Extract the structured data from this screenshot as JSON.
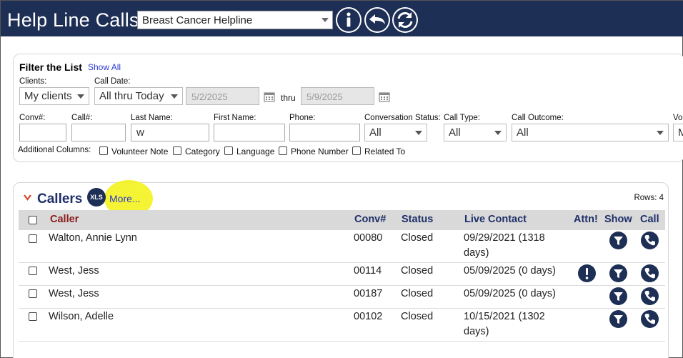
{
  "app": {
    "title": "Help Line Calls",
    "program": "Breast Cancer Helpline",
    "icons": [
      "info-icon",
      "back-icon",
      "refresh-icon"
    ]
  },
  "filter": {
    "title": "Filter the List",
    "show_all": "Show All",
    "clients_label": "Clients:",
    "clients_value": "My clients",
    "call_date_label": "Call Date:",
    "call_date_value": "All thru Today",
    "date_from": "5/2/2025",
    "thru_label": "thru",
    "date_to": "5/9/2025",
    "conv_label": "Conv#:",
    "conv_value": "",
    "call_label": "Call#:",
    "call_value": "",
    "last_name_label": "Last Name:",
    "last_name_value": "w",
    "first_name_label": "First Name:",
    "first_name_value": "",
    "phone_label": "Phone:",
    "phone_value": "",
    "conv_status_label": "Conversation Status:",
    "conv_status_value": "All",
    "call_type_label": "Call Type:",
    "call_type_value": "All",
    "call_outcome_label": "Call Outcome:",
    "call_outcome_value": "All",
    "vol_label": "Vol",
    "vol_value": "M",
    "additional_columns_label": "Additional Columns:",
    "additional_columns": [
      "Volunteer Note",
      "Category",
      "Language",
      "Phone Number",
      "Related To"
    ]
  },
  "callers": {
    "title": "Callers",
    "xls": "XLS",
    "more": "More...",
    "rows": "Rows: 4",
    "headers": {
      "caller": "Caller",
      "conv": "Conv#",
      "status": "Status",
      "live_contact": "Live Contact",
      "attn": "Attn!",
      "show": "Show",
      "call": "Call"
    },
    "rows_data": [
      {
        "caller": "Walton, Annie Lynn",
        "conv": "00080",
        "status": "Closed",
        "live1": "09/29/2021 (1318",
        "live2": "days)",
        "attn": false
      },
      {
        "caller": "West, Jess",
        "conv": "00114",
        "status": "Closed",
        "live1": "05/09/2025 (0 days)",
        "live2": "",
        "attn": true
      },
      {
        "caller": "West, Jess",
        "conv": "00187",
        "status": "Closed",
        "live1": "05/09/2025 (0 days)",
        "live2": "",
        "attn": false
      },
      {
        "caller": "Wilson, Adelle",
        "conv": "00102",
        "status": "Closed",
        "live1": "10/15/2021 (1302",
        "live2": "days)",
        "attn": false
      }
    ]
  },
  "colors": {
    "header_bg": "#1e2f55",
    "link": "#2b3bd0",
    "caller_header": "#8a1b1b",
    "highlight": "#f3f21e"
  }
}
